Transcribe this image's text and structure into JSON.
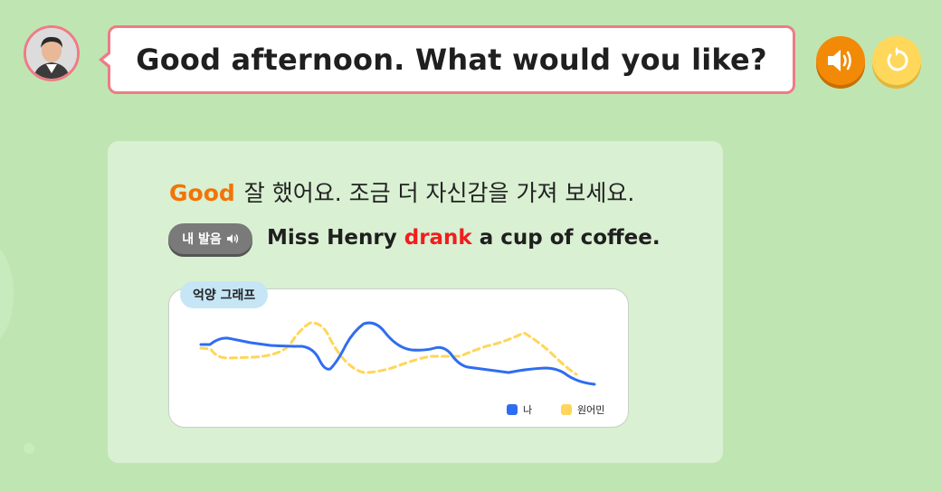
{
  "question": {
    "text": "Good afternoon. What would you like?"
  },
  "controls": {
    "sound_icon": "speaker-icon",
    "replay_icon": "replay-icon"
  },
  "feedback": {
    "grade": "Good",
    "message": "잘 했어요. 조금 더 자신감을 가져 보세요.",
    "grade_color": "#f27406"
  },
  "my_pronunciation_button": {
    "label": "내 발음"
  },
  "sentence": {
    "before": "Miss Henry",
    "highlight": "drank",
    "after": "a cup of coffee.",
    "highlight_color": "#f01e1e"
  },
  "intonation_graph": {
    "title": "억양 그래프",
    "legend": [
      {
        "label": "나",
        "color": "#2f6df0",
        "style": "solid"
      },
      {
        "label": "원어민",
        "color": "#ffd659",
        "style": "dashed"
      }
    ]
  }
}
